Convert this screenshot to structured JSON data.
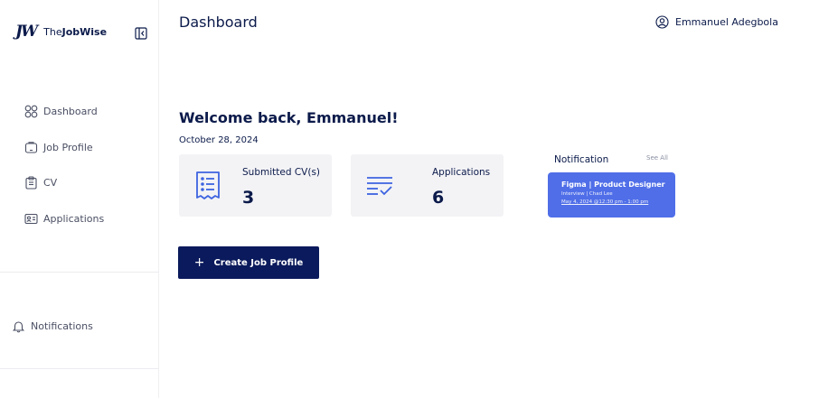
{
  "brand": {
    "mark": "JW",
    "name_prefix": "The",
    "name_bold": "JobWise"
  },
  "sidebar": {
    "items": [
      {
        "label": "Dashboard",
        "icon": "grid-icon"
      },
      {
        "label": "Job Profile",
        "icon": "briefcase-icon"
      },
      {
        "label": "CV",
        "icon": "clipboard-icon"
      },
      {
        "label": "Applications",
        "icon": "id-card-icon"
      }
    ],
    "notifications_label": "Notifications"
  },
  "header": {
    "title": "Dashboard",
    "user_name": "Emmanuel Adegbola"
  },
  "main": {
    "welcome": "Welcome back, Emmanuel!",
    "date": "October 28, 2024",
    "stats": [
      {
        "label": "Submitted CV(s)",
        "value": "3",
        "icon": "document-list-icon"
      },
      {
        "label": "Applications",
        "value": "6",
        "icon": "checklist-icon"
      }
    ],
    "notification": {
      "title": "Notification",
      "see_all": "See All",
      "card": {
        "headline": "Figma | Product Designer",
        "subline": "Interview | Chad Lee",
        "time": "May 4, 2024 @12:30 pm - 1:00 pm"
      }
    },
    "create_button": {
      "icon": "+",
      "label": "Create Job Profile"
    }
  },
  "colors": {
    "navy": "#0b1a4a",
    "button": "#0b1a5c",
    "accent": "#4f6ee8",
    "card_bg": "#f3f3f6"
  }
}
